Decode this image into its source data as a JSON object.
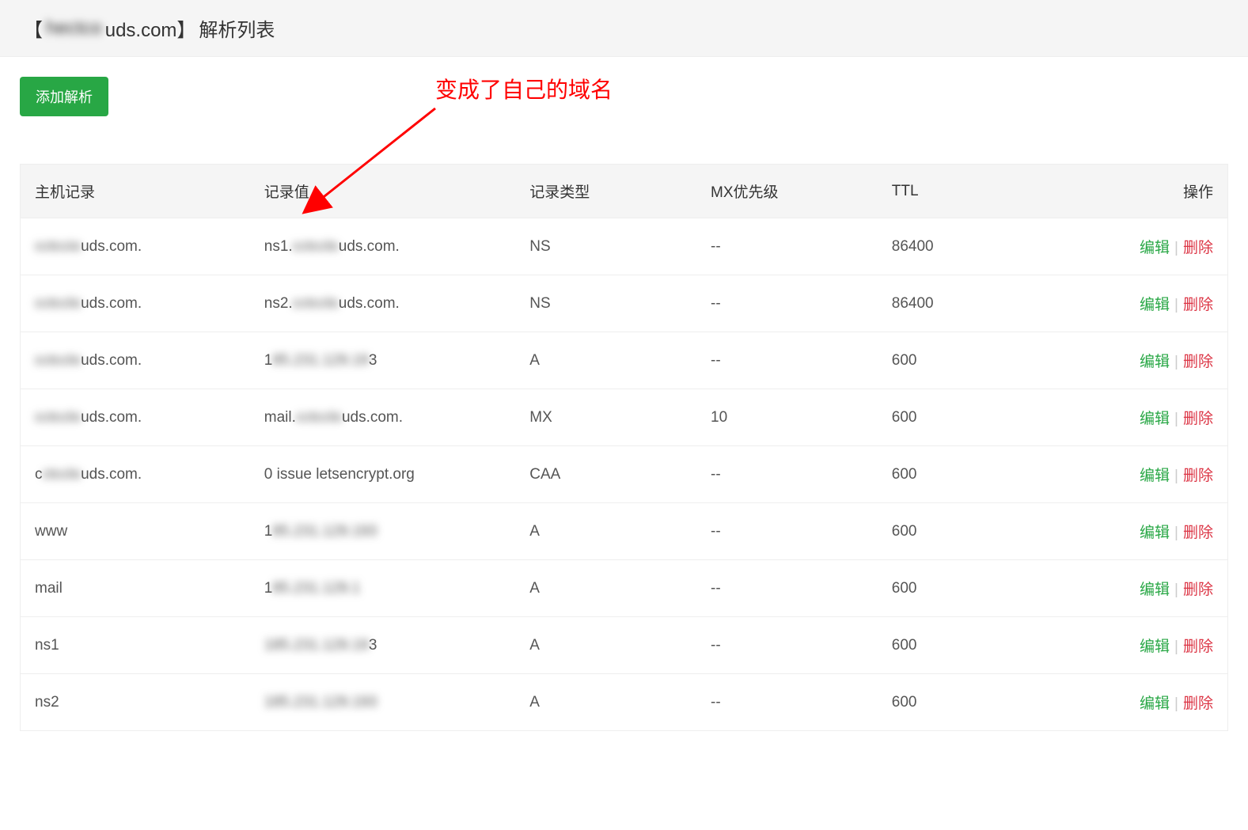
{
  "header": {
    "title_prefix": "【",
    "title_domain_blurred": "hectco",
    "title_domain_suffix": "uds.com】",
    "title_suffix": "解析列表"
  },
  "buttons": {
    "add_record": "添加解析"
  },
  "annotation": {
    "text": "变成了自己的域名"
  },
  "table": {
    "headers": {
      "host": "主机记录",
      "value": "记录值",
      "type": "记录类型",
      "mx": "MX优先级",
      "ttl": "TTL",
      "action": "操作"
    },
    "actions": {
      "edit": "编辑",
      "sep": "|",
      "delete": "删除"
    },
    "rows": [
      {
        "host_blur": "cctccio",
        "host_suffix": "uds.com.",
        "value_prefix": "ns1.",
        "value_blur": "cctcclo",
        "value_suffix": "uds.com.",
        "type": "NS",
        "mx": "--",
        "ttl": "86400"
      },
      {
        "host_blur": "cctcclo",
        "host_suffix": "uds.com.",
        "value_prefix": "ns2.",
        "value_blur": "cctcclo",
        "value_suffix": "uds.com.",
        "type": "NS",
        "mx": "--",
        "ttl": "86400"
      },
      {
        "host_blur": "cctcclo",
        "host_suffix": "uds.com.",
        "value_prefix": "1",
        "value_blur": "85.231.129.19",
        "value_suffix": "3",
        "type": "A",
        "mx": "--",
        "ttl": "600"
      },
      {
        "host_blur": "cctcclo",
        "host_suffix": "uds.com.",
        "value_prefix": "mail.",
        "value_blur": "cctcclo",
        "value_suffix": "uds.com.",
        "type": "MX",
        "mx": "10",
        "ttl": "600"
      },
      {
        "host_prefix": "c",
        "host_blur": "ctcclo",
        "host_suffix": "uds.com.",
        "value_prefix": "0 issue letsencrypt.org",
        "value_blur": "",
        "value_suffix": "",
        "type": "CAA",
        "mx": "--",
        "ttl": "600"
      },
      {
        "host_prefix": "www",
        "host_blur": "",
        "host_suffix": "",
        "value_prefix": "1",
        "value_blur": "85.231.129.193",
        "value_suffix": "",
        "type": "A",
        "mx": "--",
        "ttl": "600"
      },
      {
        "host_prefix": "mail",
        "host_blur": "",
        "host_suffix": "",
        "value_prefix": "1",
        "value_blur": "85.231.129.1",
        "value_suffix": "",
        "type": "A",
        "mx": "--",
        "ttl": "600"
      },
      {
        "host_prefix": "ns1",
        "host_blur": "",
        "host_suffix": "",
        "value_prefix": "",
        "value_blur": "185.231.129.19",
        "value_suffix": "3",
        "type": "A",
        "mx": "--",
        "ttl": "600"
      },
      {
        "host_prefix": "ns2",
        "host_blur": "",
        "host_suffix": "",
        "value_prefix": "",
        "value_blur": "185.231.129.193",
        "value_suffix": "",
        "type": "A",
        "mx": "--",
        "ttl": "600"
      }
    ]
  }
}
